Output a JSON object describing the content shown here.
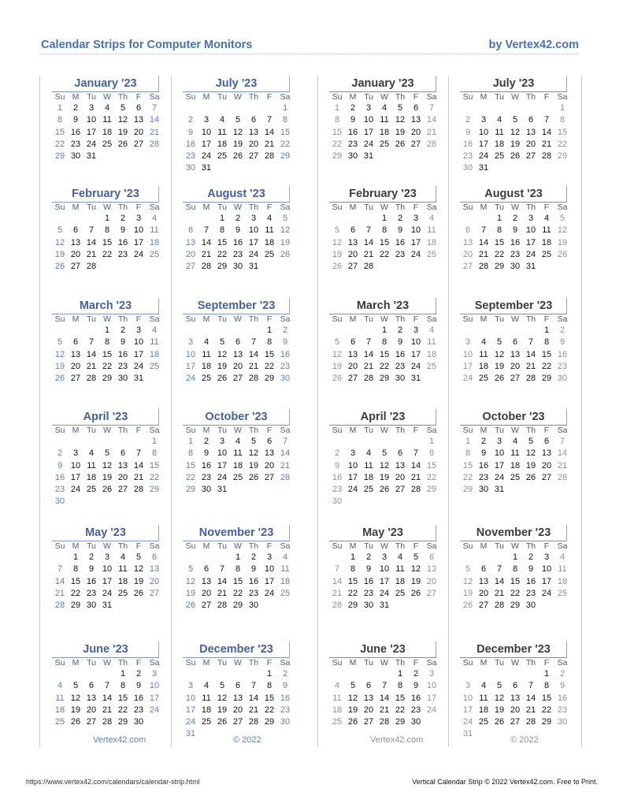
{
  "header": {
    "title": "Calendar Strips for Computer Monitors",
    "byline": "by Vertex42.com"
  },
  "weekday_labels": [
    "Su",
    "M",
    "Tu",
    "W",
    "Th",
    "F",
    "Sa"
  ],
  "theme_colors": {
    "blue_accent": "#44619e",
    "blue_weekend": "#5b7fbe",
    "gray_accent": "#3c3c3c",
    "gray_weekend": "#909090"
  },
  "months": [
    {
      "name": "January '23",
      "start": 0,
      "days": 31
    },
    {
      "name": "February '23",
      "start": 3,
      "days": 28
    },
    {
      "name": "March '23",
      "start": 3,
      "days": 31
    },
    {
      "name": "April '23",
      "start": 6,
      "days": 30
    },
    {
      "name": "May '23",
      "start": 1,
      "days": 31
    },
    {
      "name": "June '23",
      "start": 4,
      "days": 30
    },
    {
      "name": "July '23",
      "start": 6,
      "days": 31
    },
    {
      "name": "August '23",
      "start": 2,
      "days": 31
    },
    {
      "name": "September '23",
      "start": 5,
      "days": 30
    },
    {
      "name": "October '23",
      "start": 0,
      "days": 31
    },
    {
      "name": "November '23",
      "start": 3,
      "days": 30
    },
    {
      "name": "December '23",
      "start": 5,
      "days": 31
    }
  ],
  "strips": [
    {
      "theme": "blue",
      "months": [
        0,
        1,
        2,
        3,
        4,
        5
      ],
      "note": "Vertex42.com"
    },
    {
      "theme": "blue",
      "months": [
        6,
        7,
        8,
        9,
        10,
        11
      ],
      "note": "© 2022"
    },
    {
      "theme": "gray",
      "months": [
        0,
        1,
        2,
        3,
        4,
        5
      ],
      "note": "Vertex42.com"
    },
    {
      "theme": "gray",
      "months": [
        6,
        7,
        8,
        9,
        10,
        11
      ],
      "note": "© 2022"
    }
  ],
  "footer": {
    "url": "https://www.vertex42.com/calendars/calendar-strip.html",
    "copyright": "Vertical Calendar Strip © 2022 Vertex42.com. Free to Print."
  }
}
